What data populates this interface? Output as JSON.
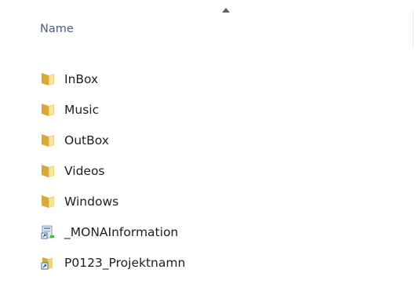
{
  "header": {
    "name_label": "Name"
  },
  "files": [
    {
      "name": "InBox",
      "icon": "folder-icon"
    },
    {
      "name": "Music",
      "icon": "folder-icon"
    },
    {
      "name": "OutBox",
      "icon": "folder-icon"
    },
    {
      "name": "Videos",
      "icon": "folder-icon"
    },
    {
      "name": "Windows",
      "icon": "folder-icon"
    },
    {
      "name": "_MONAInformation",
      "icon": "shortcut-icon"
    },
    {
      "name": "P0123_Projektnamn",
      "icon": "shortcut-icon"
    }
  ],
  "colors": {
    "header_text": "#4c607a",
    "item_text": "#1e1e1e",
    "folder_yellow": "#e8c24c"
  }
}
